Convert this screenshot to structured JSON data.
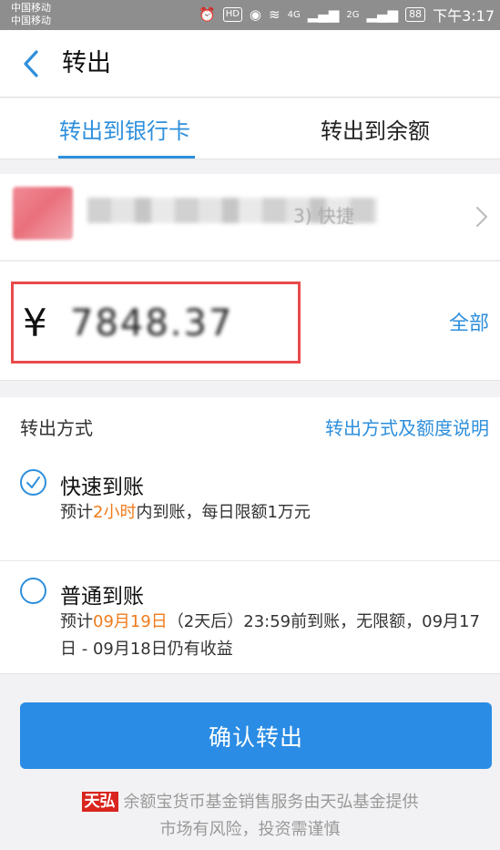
{
  "status_bar": {
    "carrier1": "中国移动",
    "carrier2": "中国移动",
    "hd": "HD",
    "signal1": "4G",
    "signal2": "2G",
    "battery": "88",
    "time": "下午3:17"
  },
  "header": {
    "title": "转出"
  },
  "tabs": [
    {
      "label": "转出到银行卡",
      "active": true
    },
    {
      "label": "转出到余额",
      "active": false
    }
  ],
  "bank_card": {
    "suffix_text": "3) 快捷"
  },
  "amount": {
    "currency": "¥",
    "value": "7848.37",
    "all_label": "全部"
  },
  "method": {
    "label": "转出方式",
    "link": "转出方式及额度说明"
  },
  "options": [
    {
      "title": "快速到账",
      "selected": true,
      "desc_prefix": "预计",
      "desc_highlight": "2小时",
      "desc_suffix": "内到账，每日限额1万元"
    },
    {
      "title": "普通到账",
      "selected": false,
      "desc_prefix": "预计",
      "desc_highlight": "09月19日",
      "desc_suffix": "（2天后）23:59前到账，无限额，09月17日 - 09月18日仍有收益"
    }
  ],
  "confirm_button": "确认转出",
  "footer": {
    "logo_text": "天弘",
    "line1": "余额宝货币基金销售服务由天弘基金提供",
    "line2": "市场有风险，投资需谨慎"
  },
  "colors": {
    "accent": "#2e8fdc",
    "highlight": "#f07c1c",
    "box_border": "#e84a4a",
    "button": "#2a8ce4"
  }
}
